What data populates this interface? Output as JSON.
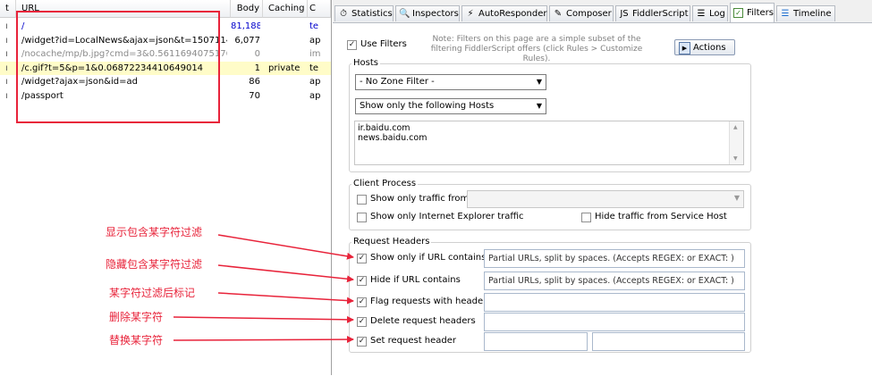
{
  "sessions": {
    "columns": {
      "url": "URL",
      "body": "Body",
      "caching": "Caching",
      "ct": "C"
    },
    "rows": [
      {
        "url": "/",
        "body": "81,188",
        "caching": "",
        "ct": "te",
        "color": "#0000cc",
        "highlight": false
      },
      {
        "url": "/widget?id=LocalNews&ajax=json&t=1507114...",
        "body": "6,077",
        "caching": "",
        "ct": "ap",
        "color": "#000000",
        "highlight": false
      },
      {
        "url": "/nocache/mp/b.jpg?cmd=3&0.5611694075176...",
        "body": "0",
        "caching": "",
        "ct": "im",
        "color": "#8a8a8a",
        "highlight": false
      },
      {
        "url": "/c.gif?t=5&p=1&0.06872234410649014",
        "body": "1",
        "caching": "private",
        "ct": "te",
        "color": "#000000",
        "highlight": true
      },
      {
        "url": "/widget?ajax=json&id=ad",
        "body": "86",
        "caching": "",
        "ct": "ap",
        "color": "#000000",
        "highlight": false
      },
      {
        "url": "/passport",
        "body": "70",
        "caching": "",
        "ct": "ap",
        "color": "#000000",
        "highlight": false
      }
    ]
  },
  "tabs": [
    {
      "label": "Statistics",
      "icon": "stopwatch-icon",
      "active": false
    },
    {
      "label": "Inspectors",
      "icon": "magnifier-icon",
      "active": false
    },
    {
      "label": "AutoResponder",
      "icon": "lightning-icon",
      "active": false
    },
    {
      "label": "Composer",
      "icon": "pencil-icon",
      "active": false
    },
    {
      "label": "FiddlerScript",
      "icon": "script-icon",
      "active": false
    },
    {
      "label": "Log",
      "icon": "log-icon",
      "active": false
    },
    {
      "label": "Filters",
      "icon": "checkbox-icon",
      "active": true
    },
    {
      "label": "Timeline",
      "icon": "timeline-icon",
      "active": false
    }
  ],
  "filters": {
    "use_filters": "Use Filters",
    "note": "Note: Filters on this page are a simple subset of the filtering FiddlerScript offers (click Rules > Customize Rules).",
    "actions": "Actions",
    "hosts": {
      "title": "Hosts",
      "zone_filter": "- No Zone Filter -",
      "host_filter": "Show only the following Hosts",
      "host_list": [
        "ir.baidu.com",
        "news.baidu.com"
      ]
    },
    "client_process": {
      "title": "Client Process",
      "show_only_traffic_from": "Show only traffic from",
      "show_only_ie": "Show only Internet Explorer traffic",
      "hide_service_host": "Hide traffic from Service Host"
    },
    "request_headers": {
      "title": "Request Headers",
      "show_if_url": "Show only if URL contains",
      "hide_if_url": "Hide if URL contains",
      "flag_requests": "Flag requests with headers",
      "delete_headers": "Delete request headers",
      "set_header": "Set request header",
      "url_placeholder": "Partial URLs, split by spaces. (Accepts REGEX: or EXACT: )"
    }
  },
  "annotations": {
    "show_contains": "显示包含某字符过滤",
    "hide_contains": "隐藏包含某字符过滤",
    "flag_after": "某字符过滤后标记",
    "delete_char": "删除某字符",
    "replace_char": "替换某字符"
  },
  "colors": {
    "annotation": "#e8233a",
    "highlight_row": "#fffcc8"
  }
}
